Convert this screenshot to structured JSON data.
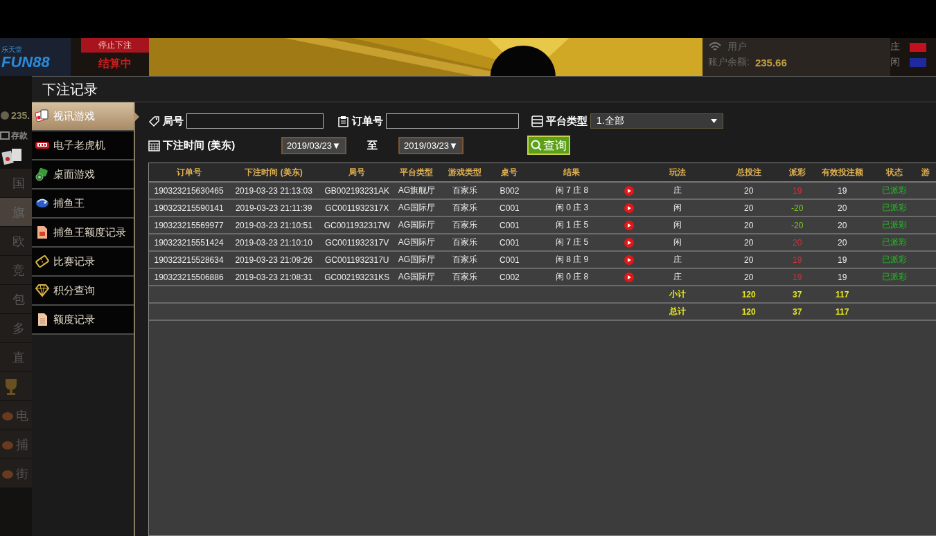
{
  "background": {
    "logo_small": "乐天堂",
    "logo": "FUN88",
    "bet_status": "停止下注",
    "round_status": "结算中",
    "user_label": "用户",
    "balance_label": "账户余额:",
    "balance": "235.66",
    "bet_sides": [
      {
        "label": "庄",
        "color": "#c4101e"
      },
      {
        "label": "闲",
        "color": "#1e2a9e"
      }
    ],
    "left_strip": {
      "balance": "235.",
      "deposit": "存款",
      "items": [
        {
          "kind": "text",
          "label": "国",
          "selected": false
        },
        {
          "kind": "text",
          "label": "旗",
          "selected": true
        },
        {
          "kind": "text",
          "label": "欧",
          "selected": false
        },
        {
          "kind": "text",
          "label": "竞",
          "selected": false
        },
        {
          "kind": "text",
          "label": "包",
          "selected": false
        },
        {
          "kind": "text",
          "label": "多",
          "selected": false
        },
        {
          "kind": "text",
          "label": "直",
          "selected": false
        },
        {
          "kind": "icon",
          "selected": false
        },
        {
          "kind": "icon_text",
          "label": "电",
          "selected": false
        },
        {
          "kind": "icon_text",
          "label": "捕",
          "selected": false
        },
        {
          "kind": "icon_text",
          "label": "街",
          "selected": false
        }
      ]
    }
  },
  "modal": {
    "title": "下注记录",
    "sidebar": {
      "items": [
        {
          "label": "视讯游戏",
          "selected": true
        },
        {
          "label": "电子老虎机",
          "selected": false
        },
        {
          "label": "桌面游戏",
          "selected": false
        },
        {
          "label": "捕鱼王",
          "selected": false
        },
        {
          "label": "捕鱼王额度记录",
          "selected": false
        },
        {
          "label": "比赛记录",
          "selected": false
        },
        {
          "label": "积分查询",
          "selected": false
        },
        {
          "label": "额度记录",
          "selected": false
        }
      ]
    },
    "filters": {
      "round_label": "局号",
      "order_label": "订单号",
      "platform_label": "平台类型",
      "platform_value": "1.全部",
      "time_label": "下注时间 (美东)",
      "date_from": "2019/03/23▼",
      "to_label": "至",
      "date_to": "2019/03/23▼",
      "query_button": "查询"
    },
    "table": {
      "columns": [
        "订单号",
        "下注时间 (美东)",
        "局号",
        "平台类型",
        "游戏类型",
        "桌号",
        "结果",
        "玩法",
        "总投注",
        "派彩",
        "有效投注额",
        "状态",
        "游"
      ],
      "rows": [
        {
          "order": "190323215630465",
          "time": "2019-03-23 21:13:03",
          "round": "GB002193231AK",
          "platform": "AG旗舰厅",
          "game": "百家乐",
          "table": "B002",
          "result": "闲 7 庄 8",
          "bet": "庄",
          "total": "20",
          "payout": {
            "text": "19",
            "color": "#d23040"
          },
          "valid": "19",
          "status": "已派彩"
        },
        {
          "order": "190323215590141",
          "time": "2019-03-23 21:11:39",
          "round": "GC0011932317X",
          "platform": "AG国际厅",
          "game": "百家乐",
          "table": "C001",
          "result": "闲 0 庄 3",
          "bet": "闲",
          "total": "20",
          "payout": {
            "text": "-20",
            "color": "#7ccc1c"
          },
          "valid": "20",
          "status": "已派彩"
        },
        {
          "order": "190323215569977",
          "time": "2019-03-23 21:10:51",
          "round": "GC0011932317W",
          "platform": "AG国际厅",
          "game": "百家乐",
          "table": "C001",
          "result": "闲 1 庄 5",
          "bet": "闲",
          "total": "20",
          "payout": {
            "text": "-20",
            "color": "#7ccc1c"
          },
          "valid": "20",
          "status": "已派彩"
        },
        {
          "order": "190323215551424",
          "time": "2019-03-23 21:10:10",
          "round": "GC0011932317V",
          "platform": "AG国际厅",
          "game": "百家乐",
          "table": "C001",
          "result": "闲 7 庄 5",
          "bet": "闲",
          "total": "20",
          "payout": {
            "text": "20",
            "color": "#d23040"
          },
          "valid": "20",
          "status": "已派彩"
        },
        {
          "order": "190323215528634",
          "time": "2019-03-23 21:09:26",
          "round": "GC0011932317U",
          "platform": "AG国际厅",
          "game": "百家乐",
          "table": "C001",
          "result": "闲 8 庄 9",
          "bet": "庄",
          "total": "20",
          "payout": {
            "text": "19",
            "color": "#d23040"
          },
          "valid": "19",
          "status": "已派彩"
        },
        {
          "order": "190323215506886",
          "time": "2019-03-23 21:08:31",
          "round": "GC002193231KS",
          "platform": "AG国际厅",
          "game": "百家乐",
          "table": "C002",
          "result": "闲 0 庄 8",
          "bet": "庄",
          "total": "20",
          "payout": {
            "text": "19",
            "color": "#d23040"
          },
          "valid": "19",
          "status": "已派彩"
        }
      ],
      "totals": [
        {
          "label": "小计",
          "total": "120",
          "payout": "37",
          "valid": "117"
        },
        {
          "label": "总计",
          "total": "120",
          "payout": "37",
          "valid": "117"
        }
      ]
    }
  }
}
